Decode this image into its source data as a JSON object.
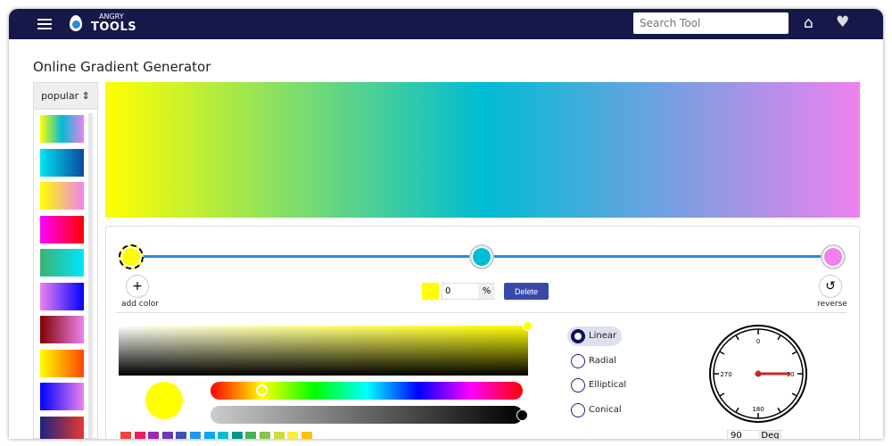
{
  "header": {
    "logo_top": "ANGRY",
    "logo_bottom": "TOOLS",
    "search_placeholder": "Search Tool"
  },
  "page": {
    "title": "Online Gradient Generator"
  },
  "sidebar": {
    "sort_select": "popular",
    "presets": [
      [
        "#ffff00",
        "#00bcd4",
        "#ee82ee"
      ],
      [
        "#00e5ee",
        "#0d47a1"
      ],
      [
        "#ffff00",
        "#ee82ee"
      ],
      [
        "#ff00ff",
        "#ff0000"
      ],
      [
        "#3cb371",
        "#00e5ff"
      ],
      [
        "#ee82ee",
        "#0000ff"
      ],
      [
        "#800000",
        "#ee82ee"
      ],
      [
        "#ffff00",
        "#ff4500"
      ],
      [
        "#0000ff",
        "#ee82ee"
      ],
      [
        "#1a237e",
        "#e53935"
      ]
    ]
  },
  "gradient": {
    "stops": [
      {
        "color": "#ffff00",
        "position": 0
      },
      {
        "color": "#00bcd4",
        "position": 50
      },
      {
        "color": "#ee82ee",
        "position": 100
      }
    ]
  },
  "controls": {
    "add_color": "add color",
    "reverse": "reverse",
    "position_value": "0",
    "percent": "%",
    "delete": "Delete"
  },
  "picker": {
    "selected_color": "#ffff00",
    "swatches": [
      "#f44336",
      "#e91e63",
      "#9c27b0",
      "#673ab7",
      "#3f51b5",
      "#2196f3",
      "#03a9f4",
      "#00bcd4",
      "#009688",
      "#4caf50",
      "#8bc34a",
      "#cddc39",
      "#ffeb3b",
      "#ffc107"
    ]
  },
  "types": {
    "options": [
      "Linear",
      "Radial",
      "Elliptical",
      "Conical"
    ],
    "selected": "Linear"
  },
  "angle": {
    "labels": [
      "0",
      "90",
      "180",
      "270"
    ],
    "value": "90",
    "unit": "Deg"
  }
}
